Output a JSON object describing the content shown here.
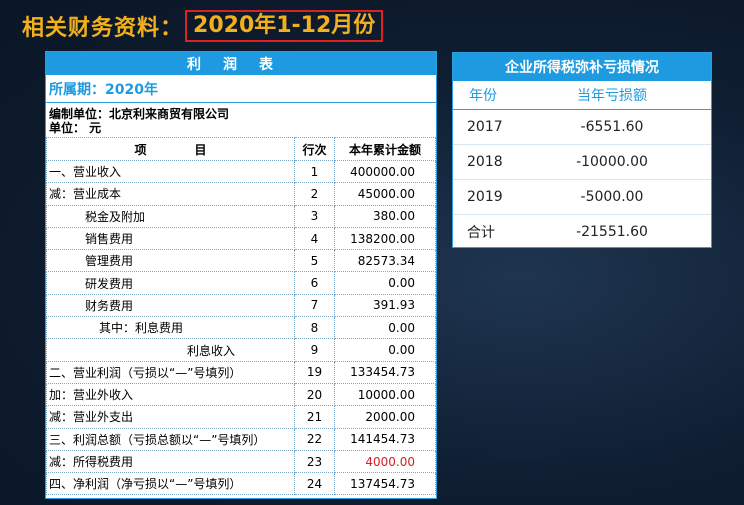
{
  "header": {
    "label": "相关财务资料：",
    "period": "2020年1-12月份"
  },
  "income_statement": {
    "title": "利润表",
    "period_label": "所属期：2020年",
    "unit_org": "编制单位：北京利来商贸有限公司",
    "unit": "单位：  元",
    "columns": [
      "项　　　　目",
      "行次",
      "本年累计金额"
    ],
    "rows": [
      {
        "item": "一、营业收入",
        "line": "1",
        "amount": "400000.00"
      },
      {
        "item": "减：营业成本",
        "line": "2",
        "amount": "45000.00"
      },
      {
        "item": "税金及附加",
        "line": "3",
        "amount": "380.00"
      },
      {
        "item": "销售费用",
        "line": "4",
        "amount": "138200.00"
      },
      {
        "item": "管理费用",
        "line": "5",
        "amount": "82573.34"
      },
      {
        "item": "研发费用",
        "line": "6",
        "amount": "0.00"
      },
      {
        "item": "财务费用",
        "line": "7",
        "amount": "391.93"
      },
      {
        "item": "其中：利息费用",
        "line": "8",
        "amount": "0.00"
      },
      {
        "item": "利息收入",
        "line": "9",
        "amount": "0.00"
      },
      {
        "item": "二、营业利润（亏损以“—”号填列）",
        "line": "19",
        "amount": "133454.73"
      },
      {
        "item": "加：营业外收入",
        "line": "20",
        "amount": "10000.00"
      },
      {
        "item": "减：营业外支出",
        "line": "21",
        "amount": "2000.00"
      },
      {
        "item": "三、利润总额（亏损总额以“—”号填列）",
        "line": "22",
        "amount": "141454.73"
      },
      {
        "item": "减：所得税费用",
        "line": "23",
        "amount": "4000.00"
      },
      {
        "item": "四、净利润（净亏损以“—”号填列）",
        "line": "24",
        "amount": "137454.73"
      }
    ],
    "highlight_color": "#d42020"
  },
  "loss_table": {
    "title": "企业所得税弥补亏损情况",
    "columns": [
      "年份",
      "当年亏损额"
    ],
    "rows": [
      {
        "year": "2017",
        "loss": "-6551.60"
      },
      {
        "year": "2018",
        "loss": "-10000.00"
      },
      {
        "year": "2019",
        "loss": "-5000.00"
      },
      {
        "year": "合计",
        "loss": "-21551.60"
      }
    ]
  },
  "colors": {
    "accent": "#1e9be0",
    "title": "#f2b01e",
    "border_highlight": "#e02020"
  }
}
